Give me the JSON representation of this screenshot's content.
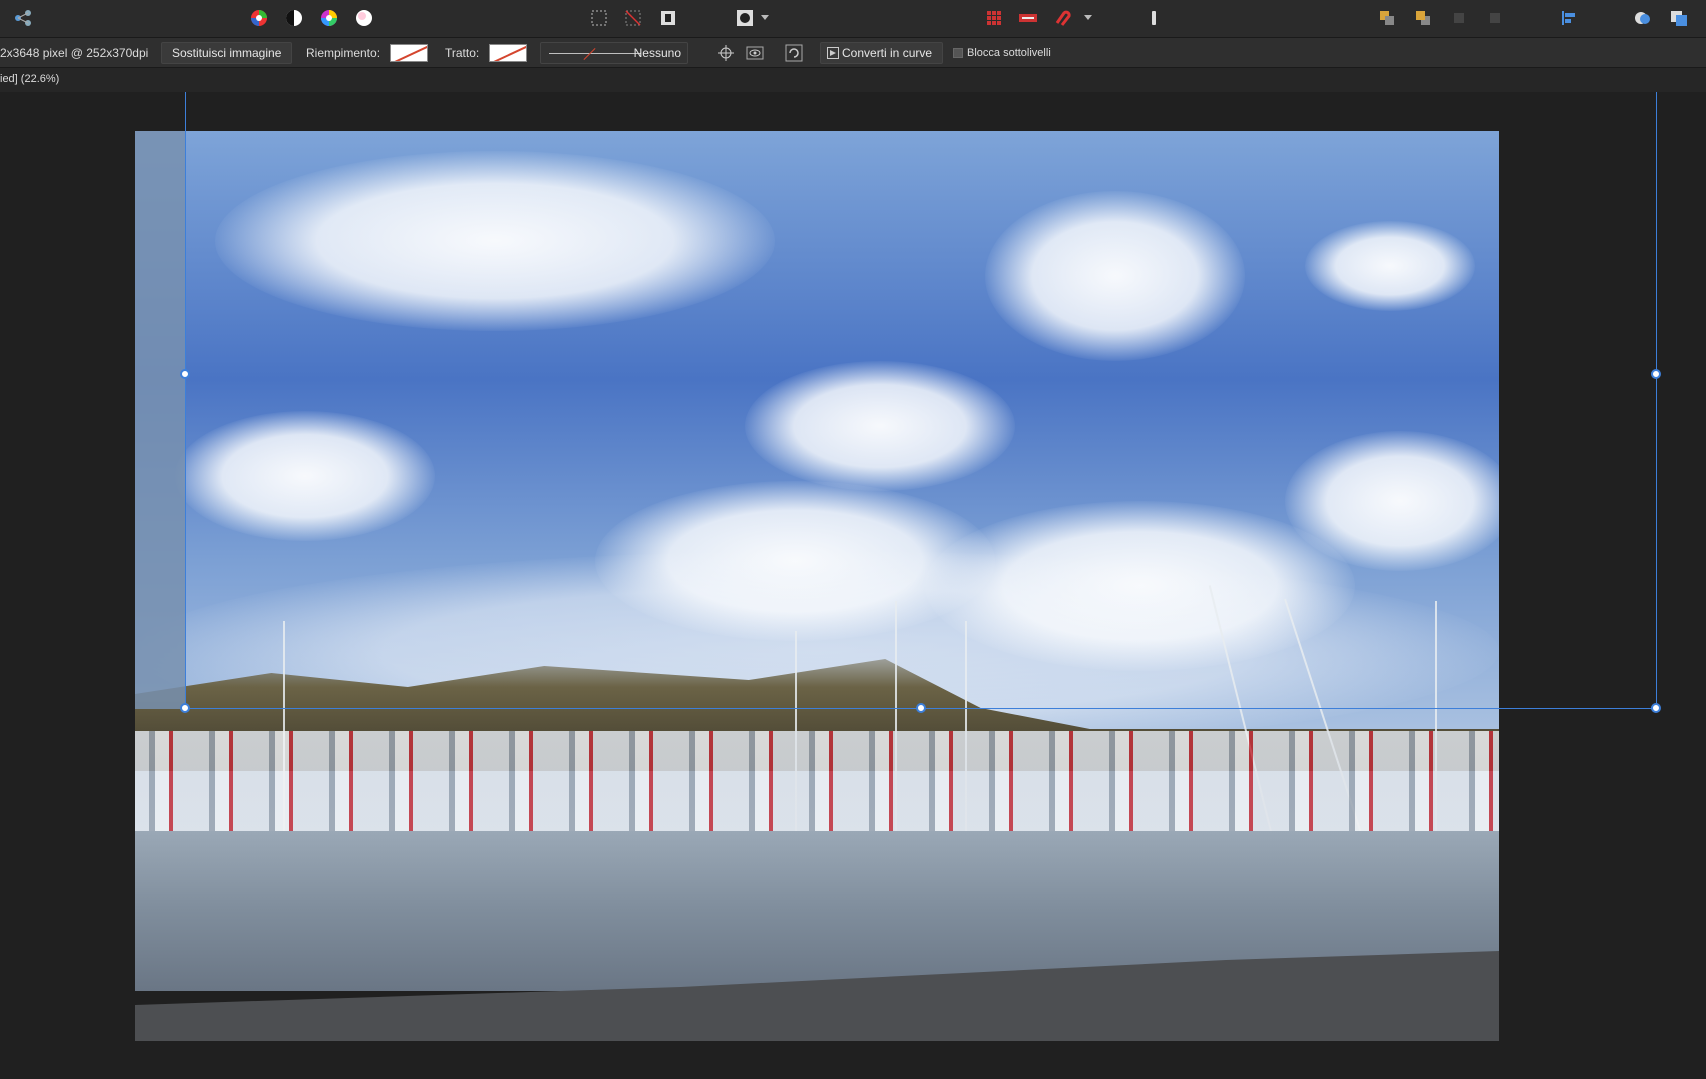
{
  "context_toolbar": {
    "image_info": "2x3648 pixel @ 252x370dpi",
    "replace_image_label": "Sostituisci immagine",
    "fill_label": "Riempimento:",
    "stroke_label": "Tratto:",
    "stroke_style": "Nessuno",
    "convert_to_curves_label": "Converti in curve",
    "lock_children_label": "Blocca sottolivelli"
  },
  "document": {
    "status": "ied] (22.6%)"
  },
  "colors": {
    "accent": "#3d7fd9",
    "background": "#1e1e1e",
    "toolbar": "#2b2b2b",
    "fill_none_slash": "#d4452e"
  }
}
